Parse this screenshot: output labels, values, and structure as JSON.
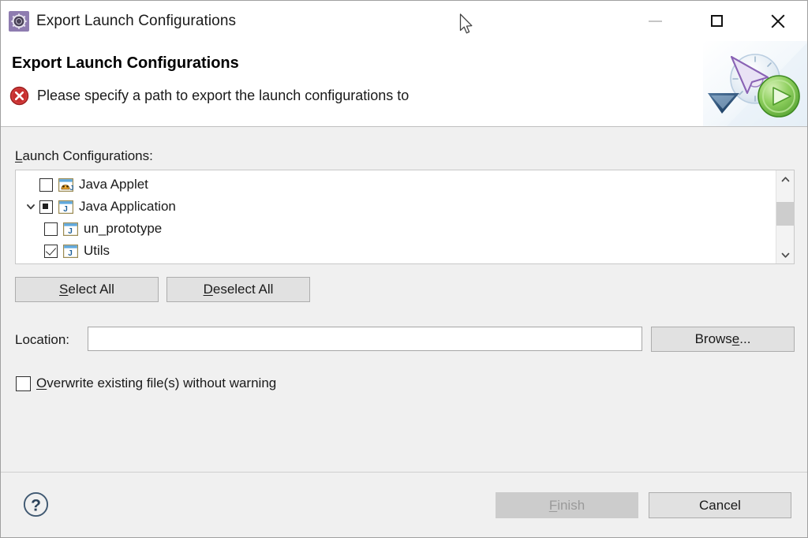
{
  "window": {
    "title": "Export Launch Configurations",
    "icon": "launch-config-gear-icon",
    "controls": {
      "minimize": "minimize-icon",
      "maximize": "maximize-icon",
      "close": "close-icon"
    }
  },
  "header": {
    "title": "Export Launch Configurations",
    "message": "Please specify a path to export the launch configurations to",
    "message_icon": "error-icon",
    "banner_icon": "launch-banner-icon"
  },
  "main": {
    "launch_configurations_label": "Launch Configurations:",
    "launch_configurations_mnemonic": "L",
    "tree": [
      {
        "label": "Java Applet",
        "state": "unchecked",
        "indent": 0,
        "expandable": false,
        "icon": "java-applet-icon"
      },
      {
        "label": "Java Application",
        "state": "partial",
        "indent": 0,
        "expandable": true,
        "expanded": true,
        "icon": "java-application-icon"
      },
      {
        "label": "un_prototype",
        "state": "unchecked",
        "indent": 1,
        "expandable": false,
        "icon": "java-application-icon"
      },
      {
        "label": "Utils",
        "state": "checked",
        "indent": 1,
        "expandable": false,
        "icon": "java-application-icon"
      }
    ],
    "select_all_label": "Select All",
    "select_all_mnemonic": "S",
    "deselect_all_label": "Deselect All",
    "deselect_all_mnemonic": "D",
    "location_label": "Location:",
    "location_value": "",
    "location_placeholder": "",
    "browse_label": "Browse...",
    "browse_mnemonic": "e",
    "overwrite_label": "Overwrite existing file(s) without warning",
    "overwrite_mnemonic": "O",
    "overwrite_checked": false
  },
  "footer": {
    "help_icon": "help-icon",
    "finish_label": "Finish",
    "finish_mnemonic": "F",
    "finish_enabled": false,
    "cancel_label": "Cancel"
  },
  "colors": {
    "dialog_background": "#f0f0f0",
    "header_background": "#ffffff",
    "error_red": "#cc2222",
    "button_face": "#e1e1e1",
    "button_disabled": "#cccccc",
    "title_icon_purple": "#8e7cb0",
    "accent_green": "#62b442",
    "accent_blue": "#2a6099"
  }
}
